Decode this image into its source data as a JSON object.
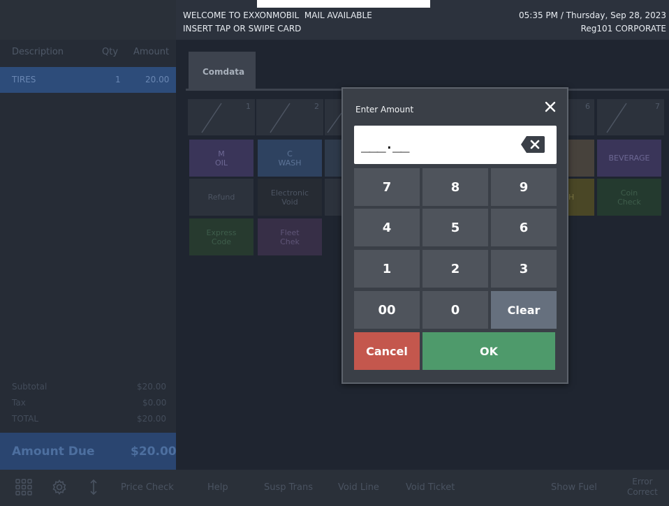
{
  "header": {
    "welcome": "WELCOME TO EXXONMOBIL",
    "mail": "MAIL AVAILABLE",
    "card_prompt": "INSERT TAP OR SWIPE CARD",
    "time": "05:35 PM",
    "date": "Thursday, Sep 28, 2023",
    "register": "Reg101",
    "store": "CORPORATE"
  },
  "ticket": {
    "columns": {
      "description": "Description",
      "qty": "Qty",
      "amount": "Amount"
    },
    "items": [
      {
        "description": "TIRES",
        "qty": "1",
        "amount": "20.00"
      }
    ],
    "subtotal_label": "Subtotal",
    "subtotal": "$20.00",
    "tax_label": "Tax",
    "tax": "$0.00",
    "total_label": "TOTAL",
    "total": "$20.00",
    "amount_due_label": "Amount Due",
    "amount_due": "$20.00"
  },
  "tabs": [
    {
      "label": "Comdata"
    }
  ],
  "slots": [
    "1",
    "2",
    "6",
    "7"
  ],
  "grid_buttons": {
    "m_oil": "M\nOIL",
    "c_wash": "C\nWASH",
    "beverage": "BEVERAGE",
    "refund": "Refund",
    "electronic_void": "Electronic\nVoid",
    "partial_h": "H",
    "coin_check": "Coin\nCheck",
    "express_code": "Express\nCode",
    "fleet_check": "Fleet\nChek"
  },
  "dialog": {
    "title": "Enter Amount",
    "amount_display": "___.__",
    "keys": {
      "k7": "7",
      "k8": "8",
      "k9": "9",
      "k4": "4",
      "k5": "5",
      "k6": "6",
      "k1": "1",
      "k2": "2",
      "k3": "3",
      "k00": "00",
      "k0": "0",
      "clear": "Clear",
      "cancel": "Cancel",
      "ok": "OK"
    }
  },
  "bottom_bar": {
    "price_check": "Price Check",
    "help": "Help",
    "susp_trans": "Susp Trans",
    "void_line": "Void Line",
    "void_ticket": "Void Ticket",
    "show_fuel": "Show Fuel",
    "error_correct_1": "Error",
    "error_correct_2": "Correct"
  },
  "colors": {
    "accent_blue": "#2d4c7a",
    "ok_green": "#4e9a6b",
    "cancel_red": "#c4574d"
  },
  "icons": [
    "grid-menu-icon",
    "gear-icon",
    "updown-arrow-icon",
    "close-icon",
    "backspace-icon"
  ]
}
